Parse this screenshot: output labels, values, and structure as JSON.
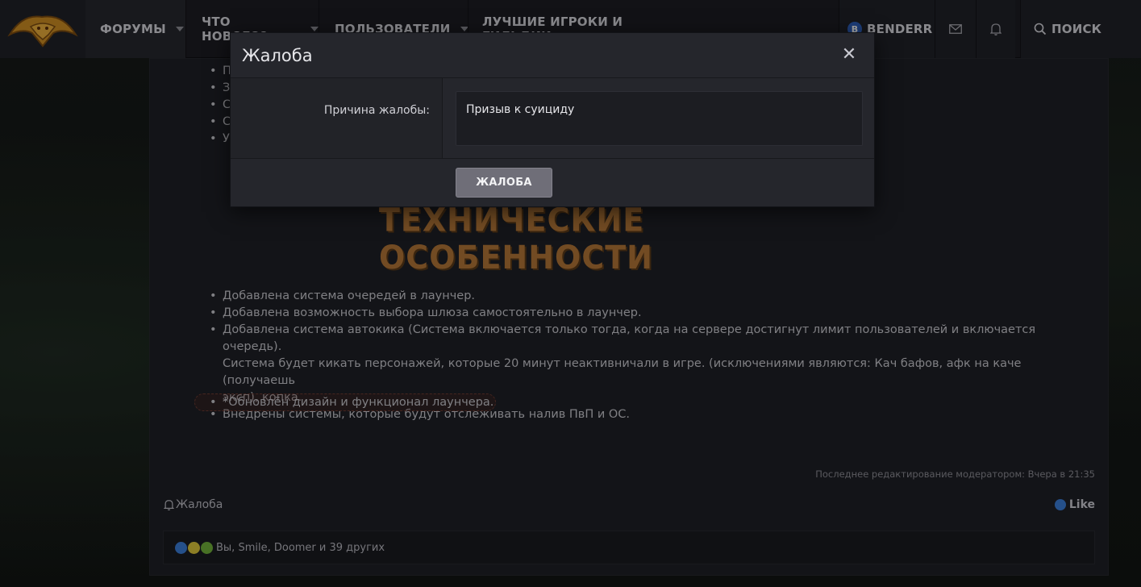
{
  "nav": {
    "items": [
      {
        "label": "ФОРУМЫ"
      },
      {
        "label": "ЧТО НОВОГО?"
      },
      {
        "label": "ПОЛЬЗОВАТЕЛИ"
      },
      {
        "label": "ЛУЧШИЕ ИГРОКИ И ГИЛЬДИИ"
      }
    ],
    "user": {
      "initial": "B",
      "name": "BENDERR"
    },
    "search_label": "ПОИСК"
  },
  "post": {
    "top_list_initials": [
      "П",
      "З",
      "С",
      "С",
      "У"
    ],
    "section_heading": "ТЕХНИЧЕСКИЕ ОСОБЕННОСТИ",
    "items": [
      "Добавлена система очередей в лаунчер.",
      "Добавлена возможность выбора шлюза самостоятельно в лаунчер.",
      "Добавлена система автокика (Система включается только тогда, когда на сервере достигнут лимит пользователей и включается очередь).",
      "Система будет кикать персонажей, которые 20 минут неактивничали в игре. (исключениями являются: Кач бафов, афк на каче (получаешь",
      "эксп), копка.",
      "Внедрены системы, которые будут отслеживать налив ПвП и ОС."
    ],
    "highlighted_item": "*Обновлён дизайн и функционал лаунчера.",
    "edited_note": "Последнее редактирование модератором: Вчера в 21:35",
    "report_label": "Жалоба",
    "like_label": "Like",
    "reactions_text": "Вы, Smile, Doomer и 39 других"
  },
  "modal": {
    "title": "Жалоба",
    "field_label": "Причина жалобы:",
    "field_value": "Призыв к суициду",
    "submit_label": "ЖАЛОБА"
  },
  "colors": {
    "accent_gold": "#b07436",
    "avatar_blue": "#2d5fb8",
    "button_gray": "#6f6e78"
  }
}
